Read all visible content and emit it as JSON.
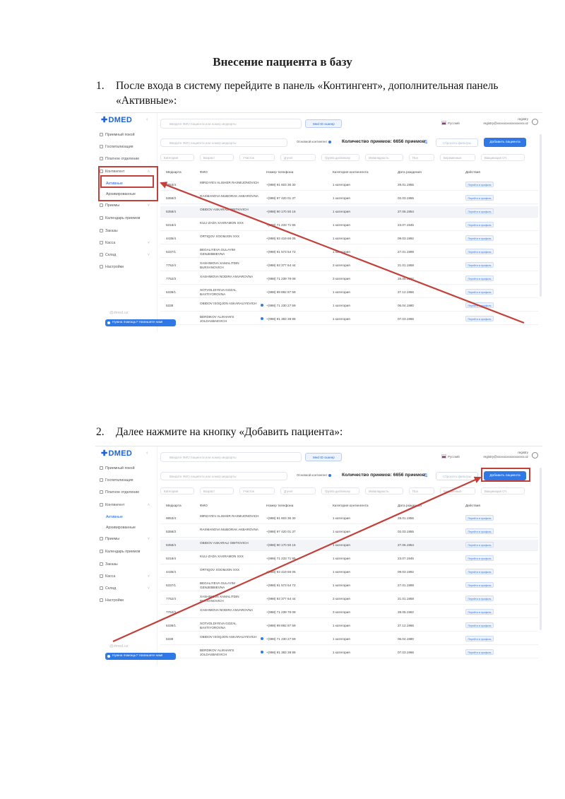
{
  "document": {
    "title": "Внесение пациента в базу",
    "steps": [
      {
        "num": "1.",
        "text": "После входа в систему перейдите в панель «Контингент», дополнительная панель «Активные»:"
      },
      {
        "num": "2.",
        "text": "Далее нажмите на кнопку «Добавить пациента»:"
      }
    ]
  },
  "app": {
    "logo": "DMED",
    "search_placeholder": "Введите ФИО пациента или номер медкарты",
    "medid_button": "Med ID сканер",
    "language": "Русский",
    "user_name": "registry",
    "user_email": "registry@xxxxxxxxxxxxxxxxx.uz",
    "sidebar": {
      "items": [
        {
          "label": "Приемный покой"
        },
        {
          "label": "Госпитализация"
        },
        {
          "label": "Платное отделение"
        },
        {
          "label": "Контингент"
        },
        {
          "label": "Активные"
        },
        {
          "label": "Архивированные"
        },
        {
          "label": "Приемы"
        },
        {
          "label": "Календарь приемов"
        },
        {
          "label": "Заказы"
        },
        {
          "label": "Касса"
        },
        {
          "label": "Склад"
        },
        {
          "label": "Настройки"
        }
      ],
      "footer": "@dmed.uz",
      "help_button": "Нужна помощь? Напишите нам!"
    },
    "toolbar": {
      "search_placeholder": "Введите ФИО пациента или номер медкарты",
      "only_active": "Основной контингент",
      "count_label": "Количество приемов: 6656 приемов",
      "reset_filters": "Сбросить фильтры",
      "add_patient": "Добавить пациента"
    },
    "filters": [
      "Категория",
      "Возраст",
      "Участок",
      "Д учет",
      "Группа диспансер",
      "Инвалидность",
      "Пол",
      "Беременные",
      "Вакцинация СЧ"
    ],
    "table": {
      "headers": [
        "Медкарта",
        "ФИО",
        "Номер телефона",
        "Категория контингента",
        "Дата рождения",
        "Действия"
      ],
      "action_label": "Перейти в профиль",
      "rows": [
        {
          "id": "9853/4",
          "name": "MIRZAYEV ALISHER RAXMIJONOVICH",
          "phone": "+(998) 91 603 36 30",
          "cat": "1 категория",
          "date": "29.01.1955"
        },
        {
          "id": "5358/3",
          "name": "RAXMANOVA MUBORAK AKBAROVNA",
          "phone": "+(998) 97 420 01 37",
          "cat": "1 категория",
          "date": "02.03.1955"
        },
        {
          "id": "5358/4",
          "name": "OBIDOV ASKARALI OBITKIVICH",
          "phone": "+(998) 90 170 50 16",
          "cat": "1 категория",
          "date": "27.06.1954"
        },
        {
          "id": "5318/4",
          "name": "KULI-ZADA XAXRAMON XXX",
          "phone": "+(998) 71 233 71 95",
          "cat": "1 категория",
          "date": "23.07.1945"
        },
        {
          "id": "4435/4",
          "name": "ORTIQOV XOOMJON XXX",
          "phone": "+(998) 93 419 66 05",
          "cat": "1 категория",
          "date": "09.03.1992"
        },
        {
          "id": "5337/1",
          "name": "BEGALIYEVA GULAYIM GENJEBBIEVNA",
          "phone": "+(998) 91 573 64 72",
          "cat": "1 категория",
          "date": "27.01.1999"
        },
        {
          "id": "7752/4",
          "name": "XASHIMOVA XAMALITDIN BURXANOVICH",
          "phone": "+(998) 93 377 64 44",
          "cat": "3 категория",
          "date": "21.01.1958"
        },
        {
          "id": "7752/3",
          "name": "XASHIMOVA NODIRA ANVAROVNA",
          "phone": "+(998) 71 239 79 08",
          "cat": "3 категория",
          "date": "28.05.1962"
        },
        {
          "id": "5338/1",
          "name": "SOTVOLDIYEVA GOZAL BAXTIYOROVNA",
          "phone": "+(998) 99 892 87 59",
          "cat": "1 категория",
          "date": "27.12.1966"
        },
        {
          "id": "5338",
          "name": "OBIDOV ISOQJON ASKARALIYEVICH",
          "phone": "+(998) 71 230 27 59",
          "cat": "1 категория",
          "date": "06.04.1980"
        },
        {
          "id": "",
          "name": "BERDIKOV ALIKHAN'S JOLDASBAEVICH",
          "phone": "+(998) 91 383 38 88",
          "cat": "1 категория",
          "date": "07.03.1966"
        }
      ]
    }
  }
}
